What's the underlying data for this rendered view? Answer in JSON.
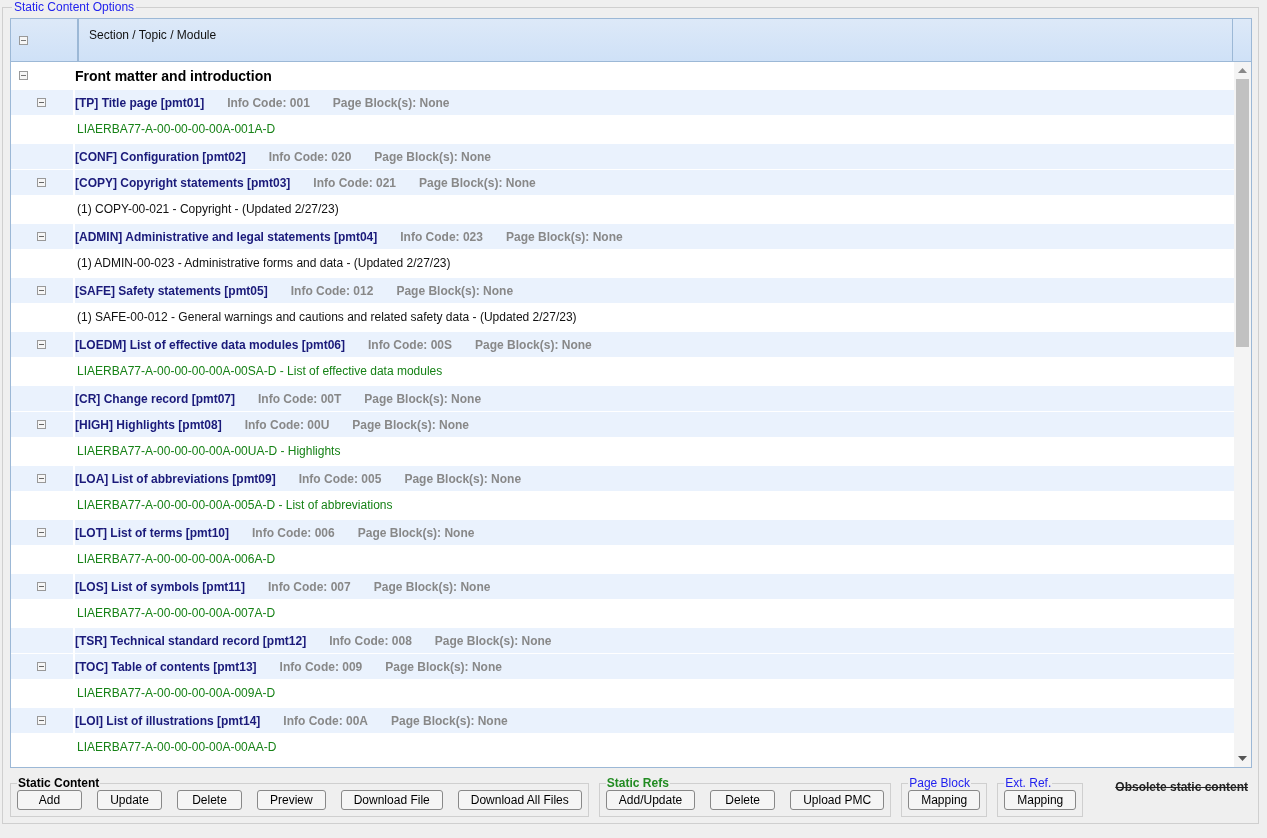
{
  "panel": {
    "title": "Static Content Options"
  },
  "table": {
    "columns": [
      "Section / Topic / Module"
    ],
    "sections": [
      {
        "title": "Front matter and introduction",
        "expanded": true,
        "topics": [
          {
            "title": "[TP] Title page [pmt01]",
            "info_code": "Info Code: 001",
            "page_blocks": "Page Block(s): None",
            "expanded": true,
            "children": [
              {
                "kind": "dm",
                "text": "LIAERBA77-A-00-00-00-00A-001A-D"
              }
            ]
          },
          {
            "title": "[CONF] Configuration [pmt02]",
            "info_code": "Info Code: 020",
            "page_blocks": "Page Block(s): None"
          },
          {
            "title": "[COPY] Copyright statements [pmt03]",
            "info_code": "Info Code: 021",
            "page_blocks": "Page Block(s): None",
            "expanded": true,
            "children": [
              {
                "kind": "file",
                "text": "(1) COPY-00-021 - Copyright - (Updated 2/27/23)"
              }
            ]
          },
          {
            "title": "[ADMIN] Administrative and legal statements [pmt04]",
            "info_code": "Info Code: 023",
            "page_blocks": "Page Block(s): None",
            "expanded": true,
            "children": [
              {
                "kind": "file",
                "text": "(1) ADMIN-00-023 - Administrative forms and data - (Updated 2/27/23)"
              }
            ]
          },
          {
            "title": "[SAFE] Safety statements [pmt05]",
            "info_code": "Info Code: 012",
            "page_blocks": "Page Block(s): None",
            "expanded": true,
            "children": [
              {
                "kind": "file",
                "text": "(1) SAFE-00-012 - General warnings and cautions and related safety data - (Updated 2/27/23)"
              }
            ]
          },
          {
            "title": "[LOEDM] List of effective data modules [pmt06]",
            "info_code": "Info Code: 00S",
            "page_blocks": "Page Block(s): None",
            "expanded": true,
            "children": [
              {
                "kind": "dm",
                "text": "LIAERBA77-A-00-00-00-00A-00SA-D - List of effective data modules"
              }
            ]
          },
          {
            "title": "[CR] Change record [pmt07]",
            "info_code": "Info Code: 00T",
            "page_blocks": "Page Block(s): None"
          },
          {
            "title": "[HIGH] Highlights [pmt08]",
            "info_code": "Info Code: 00U",
            "page_blocks": "Page Block(s): None",
            "expanded": true,
            "children": [
              {
                "kind": "dm",
                "text": "LIAERBA77-A-00-00-00-00A-00UA-D - Highlights"
              }
            ]
          },
          {
            "title": "[LOA] List of abbreviations [pmt09]",
            "info_code": "Info Code: 005",
            "page_blocks": "Page Block(s): None",
            "expanded": true,
            "children": [
              {
                "kind": "dm",
                "text": "LIAERBA77-A-00-00-00-00A-005A-D - List of abbreviations"
              }
            ]
          },
          {
            "title": "[LOT] List of terms [pmt10]",
            "info_code": "Info Code: 006",
            "page_blocks": "Page Block(s): None",
            "expanded": true,
            "children": [
              {
                "kind": "dm",
                "text": "LIAERBA77-A-00-00-00-00A-006A-D"
              }
            ]
          },
          {
            "title": "[LOS] List of symbols [pmt11]",
            "info_code": "Info Code: 007",
            "page_blocks": "Page Block(s): None",
            "expanded": true,
            "children": [
              {
                "kind": "dm",
                "text": "LIAERBA77-A-00-00-00-00A-007A-D"
              }
            ]
          },
          {
            "title": "[TSR] Technical standard record [pmt12]",
            "info_code": "Info Code: 008",
            "page_blocks": "Page Block(s): None"
          },
          {
            "title": "[TOC] Table of contents [pmt13]",
            "info_code": "Info Code: 009",
            "page_blocks": "Page Block(s): None",
            "expanded": true,
            "children": [
              {
                "kind": "dm",
                "text": "LIAERBA77-A-00-00-00-00A-009A-D"
              }
            ]
          },
          {
            "title": "[LOI] List of illustrations [pmt14]",
            "info_code": "Info Code: 00A",
            "page_blocks": "Page Block(s): None",
            "expanded": true,
            "children": [
              {
                "kind": "dm",
                "text": "LIAERBA77-A-00-00-00-00A-00AA-D"
              }
            ]
          }
        ]
      }
    ]
  },
  "groups": [
    {
      "kind": "black",
      "title": "Static Content",
      "buttons": [
        "Add",
        "Update",
        "Delete",
        "Preview",
        "Download File",
        "Download All Files"
      ]
    },
    {
      "kind": "green",
      "title": "Static Refs",
      "buttons": [
        "Add/Update",
        "Delete",
        "Upload PMC"
      ]
    },
    {
      "kind": "blue",
      "title": "Page Block",
      "buttons": [
        "Mapping"
      ]
    },
    {
      "kind": "blue",
      "title": "Ext. Ref.",
      "buttons": [
        "Mapping"
      ]
    }
  ],
  "obsolete_link": "Obsolete static content"
}
